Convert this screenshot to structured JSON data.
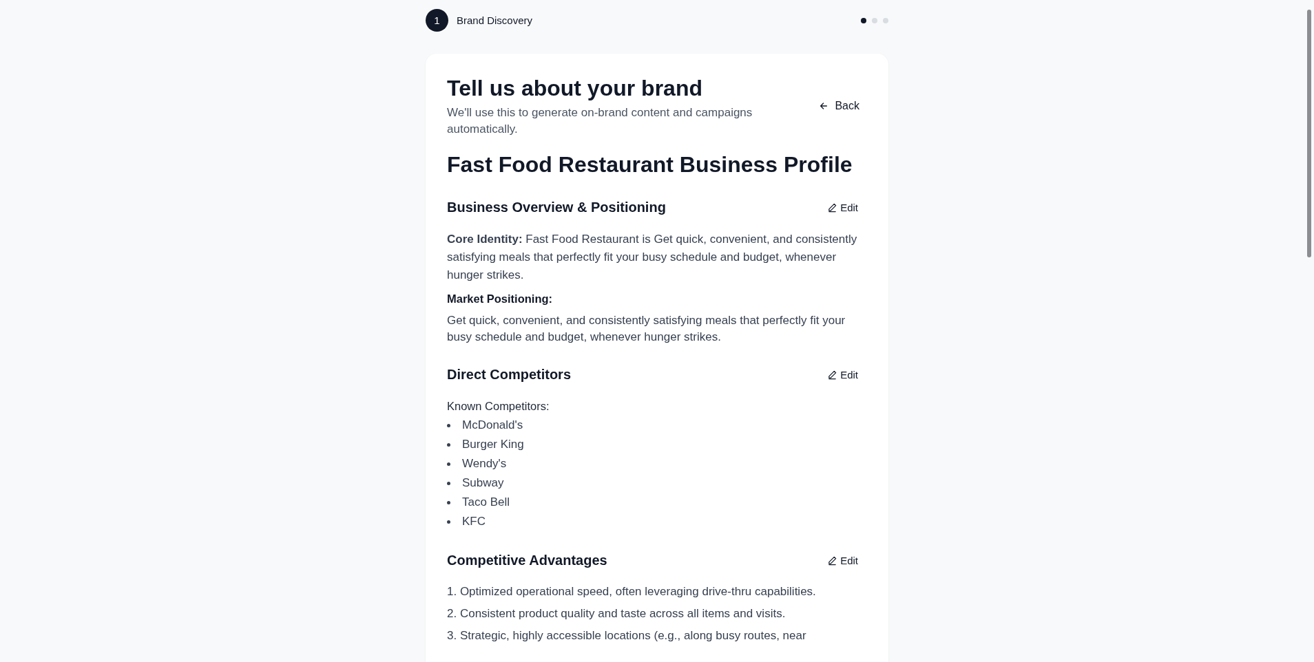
{
  "stepper": {
    "number": "1",
    "label": "Brand Discovery",
    "dots": [
      {
        "selected": true
      },
      {
        "selected": false
      },
      {
        "selected": false
      }
    ]
  },
  "header": {
    "title": "Tell us about your brand",
    "subtitle": "We'll use this to generate on-brand content and campaigns automatically.",
    "back": "Back"
  },
  "profile_title": "Fast Food Restaurant Business Profile",
  "sections": [
    {
      "kind": "overview",
      "title": "Business Overview & Positioning",
      "edit": "Edit",
      "identity": "**Core Identity:** Fast Food Restaurant is Get quick, convenient, and consistently satisfying meals that perfectly fit your busy schedule and budget, whenever hunger strikes.",
      "positioning_label": "Market Positioning:",
      "positioning": "Get quick, convenient, and consistently satisfying meals that perfectly fit your busy schedule and budget, whenever hunger strikes."
    },
    {
      "kind": "bullets",
      "title": "Direct Competitors",
      "edit": "Edit",
      "label": "Known Competitors:",
      "items": [
        "McDonald's",
        "Burger King",
        "Wendy's",
        "Subway",
        "Taco Bell",
        "KFC"
      ]
    },
    {
      "kind": "numbered",
      "title": "Competitive Advantages",
      "edit": "Edit",
      "items": [
        "1. Optimized operational speed, often leveraging drive-thru capabilities.",
        "2. Consistent product quality and taste across all items and visits.",
        "3. Strategic, highly accessible locations (e.g., along busy routes, near"
      ]
    }
  ]
}
